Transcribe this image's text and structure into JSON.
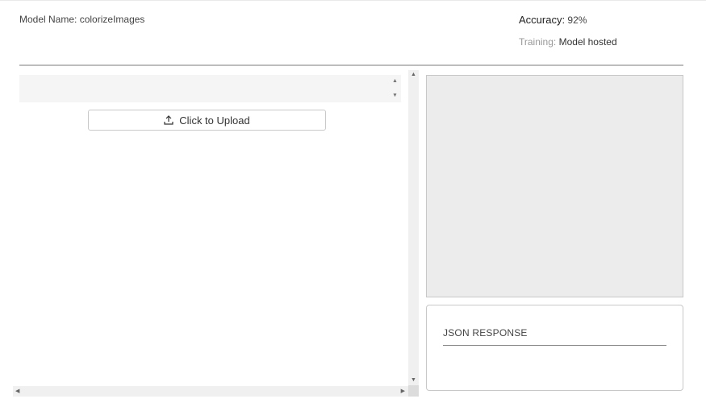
{
  "model": {
    "name_label": "Model Name:",
    "name_value": "colorizeImages"
  },
  "accuracy": {
    "label": "Accuracy:",
    "value": "92%"
  },
  "training": {
    "label": "Training:",
    "value": "Model hosted"
  },
  "upload": {
    "label": "Click to Upload",
    "icon": "upload-icon"
  },
  "json_response": {
    "label": "JSON RESPONSE"
  },
  "scroll_arrows": {
    "up": "▲",
    "down": "▼",
    "left": "◀",
    "right": "▶"
  }
}
